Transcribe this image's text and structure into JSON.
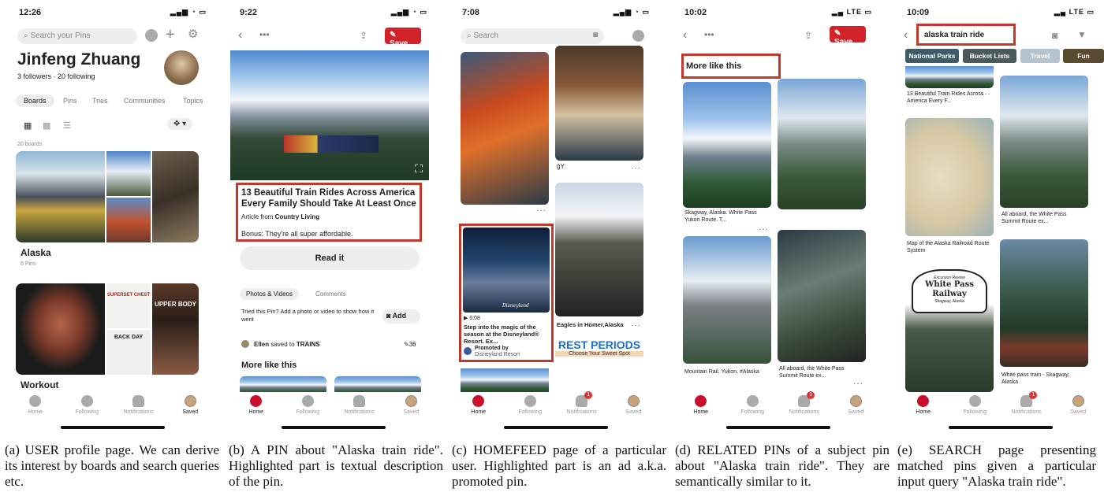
{
  "panels": {
    "profile": {
      "time": "12:26",
      "search_placeholder": "Search your Pins",
      "name": "Jinfeng Zhuang",
      "followers": "3 followers · 20 following",
      "tabs": [
        "Boards",
        "Pins",
        "Tries",
        "Communities",
        "Topics"
      ],
      "board_count": "20 boards",
      "board1": {
        "title": "Alaska",
        "sub": "6 Pins"
      },
      "board2": {
        "title": "Workout",
        "img_text1": "SUPERSET CHEST",
        "img_text2": "UPPER BODY",
        "img_text3": "BACK DAY"
      }
    },
    "pin": {
      "time": "9:22",
      "save": "Save",
      "title": "13 Beautiful Train Rides Across America Every Family Should Take At Least Once",
      "article_prefix": "Article from ",
      "article_source": "Country Living",
      "bonus": "Bonus: They're all super affordable.",
      "read": "Read it",
      "tab_photos": "Photos & Videos",
      "tab_comments": "Comments",
      "tried": "Tried this Pin? Add a photo or video to show how it went",
      "add": "Add",
      "saver": "Ellen",
      "saved_to": " saved to ",
      "board": "TRAINS",
      "saves": "36",
      "more": "More like this"
    },
    "home": {
      "time": "7:08",
      "search_placeholder": "Search",
      "ad_duration": "0:08",
      "ad_title": "Step into the magic of the season at the Disneyland® Resort. Ex...",
      "promoted_by": "Promoted by",
      "advertiser": "Disneyland Resort",
      "pin_caption": "Eagles in Homer,Alaska",
      "rest_title": "REST PERIODS",
      "rest_sub": "Choose Your Sweet Spot",
      "odd_label": "ĝY",
      "ad_logo": "Disneyland"
    },
    "related": {
      "time": "10:02",
      "save": "Save",
      "more": "More like this",
      "cap1": "Skagway, Alaska. White Pass Yukon Route. T...",
      "cap2": "Mountain Rail, Yukon, #Alaska",
      "cap3": "All aboard, the White Pass Summit Route ex..."
    },
    "search": {
      "time": "10:09",
      "query": "alaska train ride",
      "chips": [
        "National Parks",
        "Bucket Lists",
        "Travel",
        "Fun"
      ],
      "cap1": "13 Beautiful Train Rides Across America Every F...",
      "cap2": "Map of the Alaska Railroad Route System",
      "cap3": "All aboard, the White Pass Summit Route ex...",
      "cap4": "White pass train - Skagway, Alaska",
      "sign_top": "Excursion Review",
      "sign_main": "White Pass Railway",
      "sign_sub": "Skagway, Alaska"
    }
  },
  "tabbar": [
    "Home",
    "Following",
    "Notifications",
    "Saved"
  ],
  "notif_badge": "1",
  "network": "LTE",
  "captions": [
    "(a) USER profile page. We can derive its interest by boards and search queries etc.",
    "(b) A PIN about \"Alaska train ride\". Highlighted part is textual description of the pin.",
    "(c) HOMEFEED page of a particular user. Highlighted part is an ad a.k.a. promoted pin.",
    "(d) RELATED PINs of a subject pin about \"Alaska train ride\". They are semantically similar to it.",
    "(e) SEARCH page presenting matched pins given a particular input query \"Alaska train ride\"."
  ]
}
